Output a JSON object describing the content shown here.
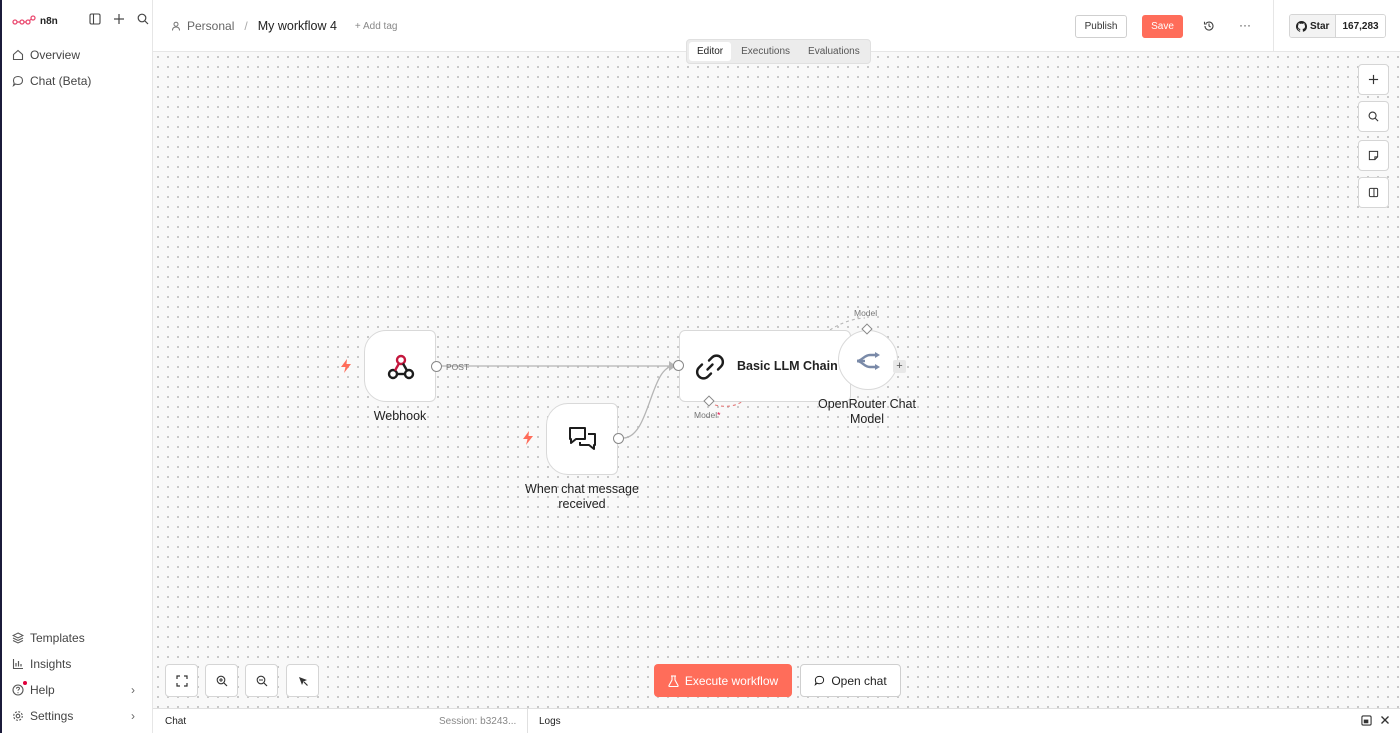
{
  "app": {
    "name": "n8n"
  },
  "sidebar": {
    "items": [
      {
        "label": "Overview"
      },
      {
        "label": "Chat (Beta)"
      }
    ],
    "bottom_items": [
      {
        "label": "Templates"
      },
      {
        "label": "Insights"
      },
      {
        "label": "Help"
      },
      {
        "label": "Settings"
      }
    ]
  },
  "header": {
    "project": "Personal",
    "workflow_name": "My workflow 4",
    "add_tag": "+ Add tag",
    "publish_label": "Publish",
    "save_label": "Save",
    "more_label": "···",
    "github": {
      "star_label": "Star",
      "count": "167,283"
    }
  },
  "tabs": [
    {
      "label": "Editor",
      "active": true
    },
    {
      "label": "Executions",
      "active": false
    },
    {
      "label": "Evaluations",
      "active": false
    }
  ],
  "nodes": {
    "webhook": {
      "label": "Webhook",
      "output_label": "POST"
    },
    "chat_trigger": {
      "label_line1": "When chat message",
      "label_line2": "received"
    },
    "llm_chain": {
      "label": "Basic LLM Chain",
      "model_port_label": "Model",
      "required_mark": "*"
    },
    "openrouter": {
      "label_line1": "OpenRouter Chat",
      "label_line2": "Model",
      "model_port_label": "Model"
    }
  },
  "canvas_actions": {
    "execute_label": "Execute workflow",
    "open_chat_label": "Open chat"
  },
  "bottom_panel": {
    "chat_label": "Chat",
    "session_label": "Session: b3243...",
    "logs_label": "Logs"
  },
  "colors": {
    "accent": "#ff6d5a",
    "canvas_bg": "#f9f9f9",
    "trigger_bolt": "#ff6d5a"
  },
  "icons": [
    "n8n-logo-icon",
    "sidebar-toggle-icon",
    "plus-icon",
    "search-icon",
    "home-icon",
    "chat-bubble-icon",
    "templates-icon",
    "insights-icon",
    "help-icon",
    "settings-icon",
    "user-icon",
    "history-icon",
    "github-icon",
    "zoom-in-icon",
    "zoom-out-icon",
    "fit-view-icon",
    "cursor-icon",
    "sticky-note-icon",
    "panel-icon",
    "webhook-icon",
    "chat-messages-icon",
    "link-icon",
    "openrouter-icon",
    "bolt-icon",
    "flask-icon",
    "popout-icon",
    "close-icon"
  ]
}
